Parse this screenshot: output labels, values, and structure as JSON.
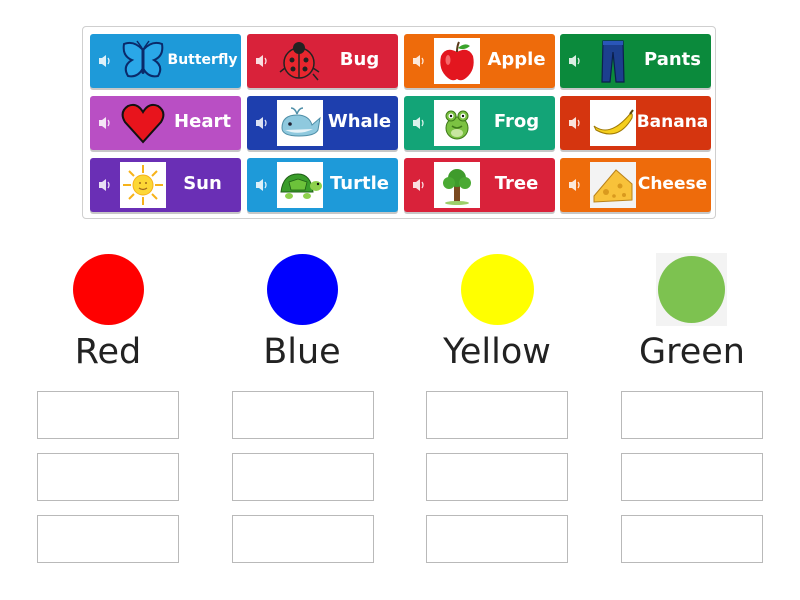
{
  "tiles": [
    {
      "label": "Butterfly",
      "color": "#1e9ad9",
      "icon": "butterfly-icon"
    },
    {
      "label": "Bug",
      "color": "#d9223a",
      "icon": "ladybug-icon"
    },
    {
      "label": "Apple",
      "color": "#ee6b0b",
      "icon": "apple-icon"
    },
    {
      "label": "Pants",
      "color": "#0b8a3c",
      "icon": "pants-icon"
    },
    {
      "label": "Heart",
      "color": "#b94fc4",
      "icon": "heart-icon"
    },
    {
      "label": "Whale",
      "color": "#1e3fae",
      "icon": "whale-icon"
    },
    {
      "label": "Frog",
      "color": "#13a477",
      "icon": "frog-icon"
    },
    {
      "label": "Banana",
      "color": "#d5350f",
      "icon": "banana-icon"
    },
    {
      "label": "Sun",
      "color": "#6a2fb5",
      "icon": "sun-icon"
    },
    {
      "label": "Turtle",
      "color": "#1e9ad9",
      "icon": "turtle-icon"
    },
    {
      "label": "Tree",
      "color": "#d9223a",
      "icon": "tree-icon"
    },
    {
      "label": "Cheese",
      "color": "#ee6b0b",
      "icon": "cheese-icon"
    }
  ],
  "categories": [
    {
      "label": "Red",
      "color": "#ff0000"
    },
    {
      "label": "Blue",
      "color": "#0000ff"
    },
    {
      "label": "Yellow",
      "color": "#ffff00"
    },
    {
      "label": "Green",
      "color": "#7dc250"
    }
  ]
}
